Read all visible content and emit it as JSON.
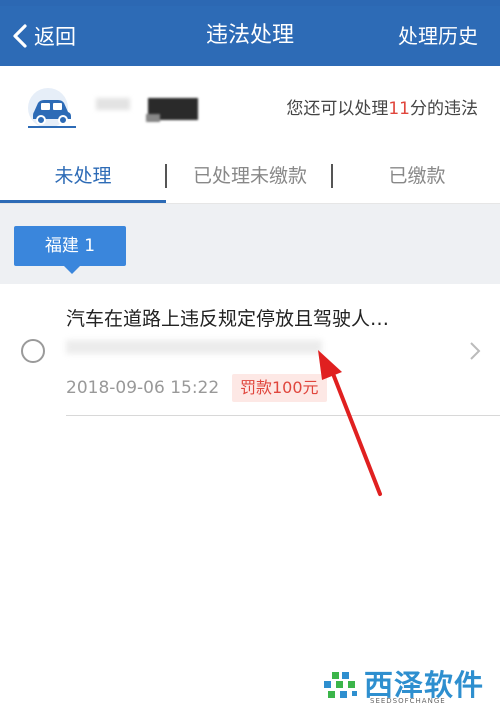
{
  "nav": {
    "back_label": "返回",
    "title": "违法处理",
    "history_label": "处理历史"
  },
  "vehicle": {
    "points_prefix": "您还可以处理",
    "points_value": "11",
    "points_suffix": "分的违法"
  },
  "tabs": [
    {
      "label": "未处理",
      "active": true
    },
    {
      "label": "已处理未缴款",
      "active": false
    },
    {
      "label": "已缴款",
      "active": false
    }
  ],
  "region": {
    "label": "福建 1"
  },
  "violations": [
    {
      "title": "汽车在道路上违反规定停放且驾驶人…",
      "time": "2018-09-06 15:22",
      "fine": "罚款100元"
    }
  ],
  "watermark": {
    "brand": "西泽软件",
    "tagline": "SEEDSOFCHANGE"
  },
  "colors": {
    "primary": "#2d6bb6",
    "badge_blue": "#3a86dc",
    "fine_red": "#e0463d",
    "annotation_arrow": "#e02020"
  }
}
